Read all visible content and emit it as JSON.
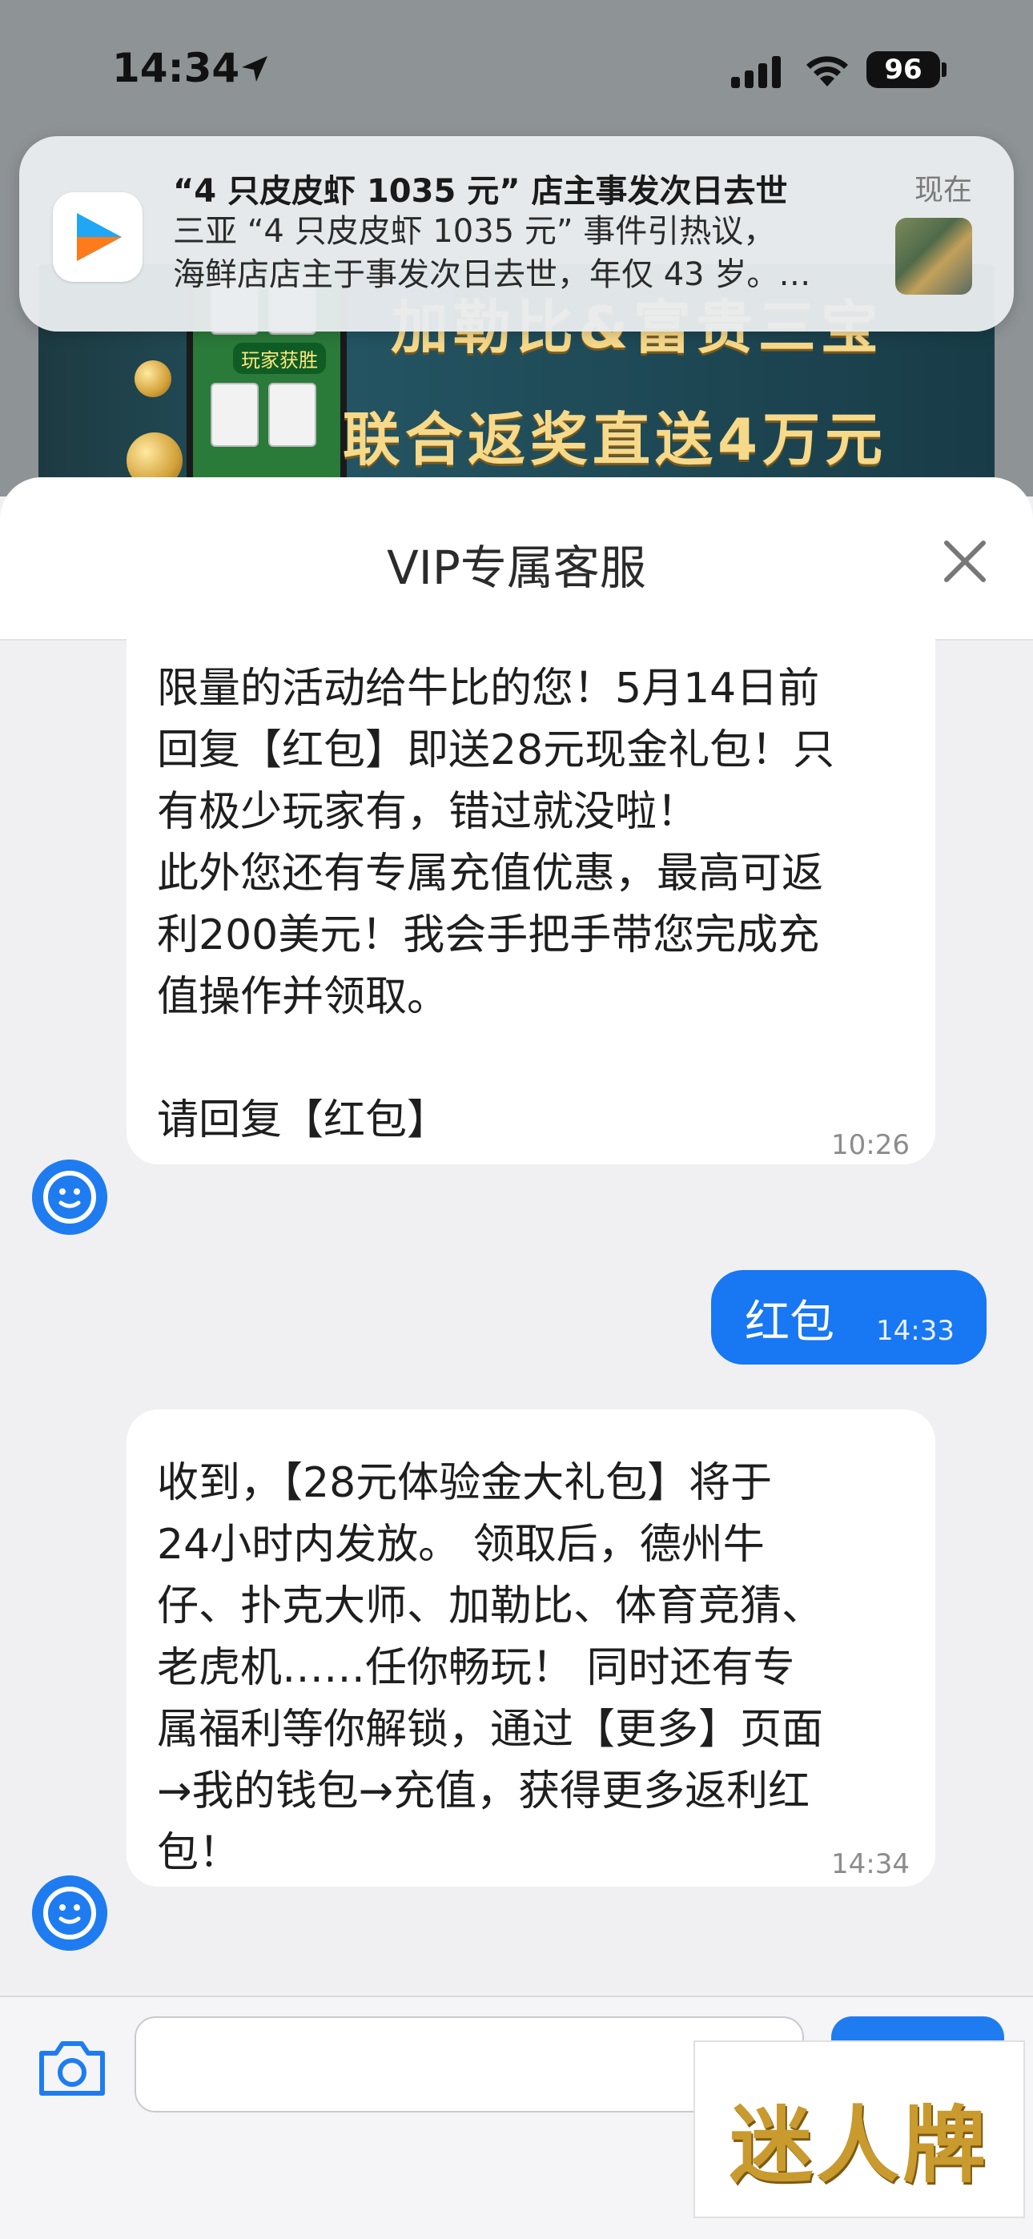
{
  "status_bar": {
    "time": "14:34",
    "battery": "96"
  },
  "background_banner": {
    "line1": "加勒比&富贵三宝",
    "line2": "联合返奖直送4万元",
    "play_tag": "玩家获胜"
  },
  "notification": {
    "title": "“4 只皮皮虾 1035 元” 店主事发次日去世",
    "body_line1": "三亚 “4 只皮皮虾 1035 元” 事件引热议，",
    "body_line2": "海鲜店店主于事发次日去世，年仅 43 岁。…",
    "time": "现在"
  },
  "sheet": {
    "title": "VIP专属客服"
  },
  "messages": [
    {
      "direction": "incoming",
      "lines": [
        "限量的活动给牛比的您！5月14日前",
        "回复【红包】即送28元现金礼包！只",
        "有极少玩家有，错过就没啦！",
        "此外您还有专属充值优惠，最高可返",
        "利200美元！我会手把手带您完成充",
        "值操作并领取。",
        "",
        "请回复【红包】"
      ],
      "time": "10:26"
    },
    {
      "direction": "outgoing",
      "text": "红包",
      "time": "14:33"
    },
    {
      "direction": "incoming",
      "lines": [
        "收到，【28元体验金大礼包】将于",
        "24小时内发放。 领取后，德州牛",
        "仔、扑克大师、加勒比、体育竞猜、",
        "老虎机……任你畅玩！ 同时还有专",
        "属福利等你解锁，通过【更多】页面",
        "→我的钱包→充值，获得更多返利红",
        "包！"
      ],
      "time": "14:34"
    }
  ],
  "composer": {
    "placeholder": "",
    "value": ""
  },
  "watermark": "迷人牌",
  "colors": {
    "accent": "#1f7cf0",
    "outgoing_bubble": "#1877f2",
    "chat_background": "#f0f0f3"
  },
  "icons": [
    "location-arrow-icon",
    "signal-icon",
    "wifi-icon",
    "battery-icon",
    "app-play-icon",
    "close-icon",
    "agent-avatar-icon",
    "camera-icon"
  ]
}
